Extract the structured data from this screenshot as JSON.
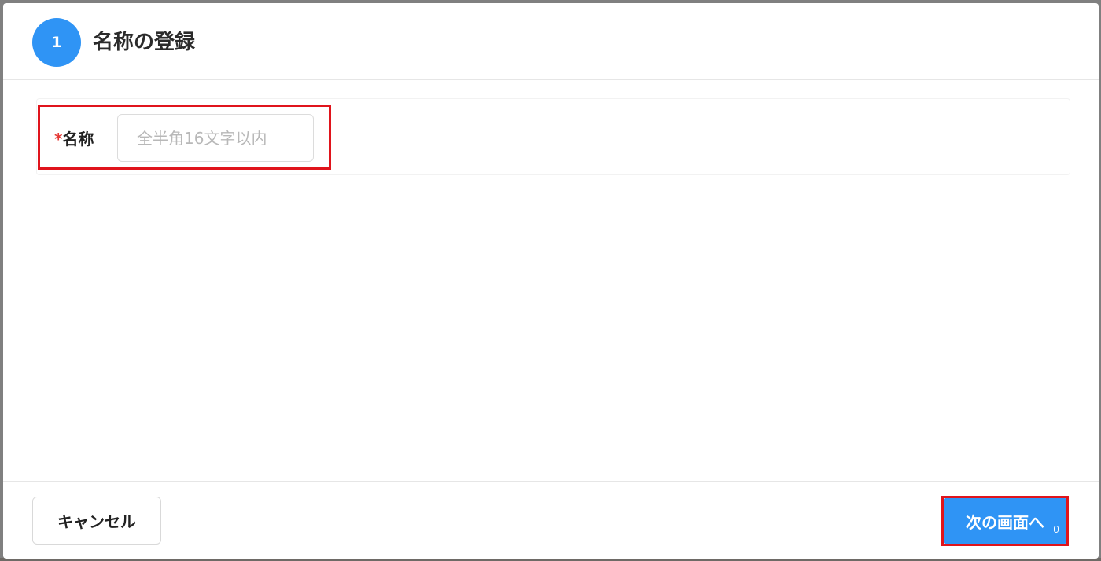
{
  "header": {
    "step_number": "1",
    "title": "名称の登録"
  },
  "form": {
    "name_field": {
      "required_mark": "*",
      "label": "名称",
      "value": "",
      "placeholder": "全半角16文字以内"
    }
  },
  "footer": {
    "cancel_label": "キャンセル",
    "next_label": "次の画面へ"
  },
  "colors": {
    "accent": "#2f94f5",
    "highlight_border": "#e0141c",
    "required": "#e53935"
  }
}
